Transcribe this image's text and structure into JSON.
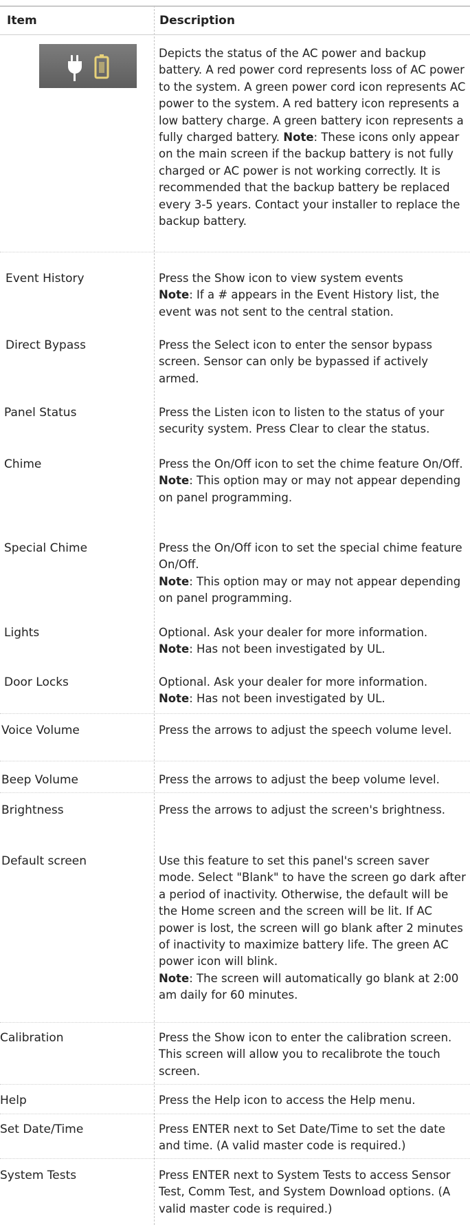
{
  "header": {
    "item": "Item",
    "description": "Description"
  },
  "colors": {
    "icon_background": "#666666",
    "icon_foreground": "#ffffff"
  },
  "rows": [
    {
      "item": "",
      "icons": [
        "ac-power-cord-icon",
        "backup-battery-icon"
      ],
      "description": "Depicts the status of the AC power and backup battery. A red power cord represents loss of AC power to the system. A green power cord icon represents AC power to the system. A red battery icon represents a low battery charge. A green battery icon represents a fully charged battery.",
      "note_label": "Note",
      "note": ": These icons only appear on the main screen if the backup battery is not fully charged or AC power is not working correctly. It is recommended that the  backup battery be replaced every 3-5 years. Contact your installer to replace the backup battery."
    },
    {
      "item": "Event History",
      "description": "Press the Show icon to view system events",
      "note_label": "Note",
      "note": ": If a # appears in the Event History list, the event was not sent to the central station."
    },
    {
      "item": "Direct Bypass",
      "description": "Press the Select icon to enter the sensor bypass screen. Sensor can only be bypassed if actively armed."
    },
    {
      "item": "Panel Status",
      "description": "Press the Listen icon to listen to the status of your security system.  Press Clear to clear the status."
    },
    {
      "item": "Chime",
      "description": "Press the On/Off icon to set the chime feature On/Off.",
      "note_label": "Note",
      "note": ": This option may or may not appear depending on panel programming."
    },
    {
      "item": "Special Chime",
      "description": "Press the On/Off icon to set the special chime feature On/Off.",
      "note_label": "Note",
      "note": ": This option may or may not appear depending on panel programming."
    },
    {
      "item": "Lights",
      "description": "Optional.  Ask your dealer for more information.",
      "note_label": "Note",
      "note": ": Has not been investigated by UL."
    },
    {
      "item": "Door Locks",
      "description": "Optional.  Ask your dealer for more information.",
      "note_label": "Note",
      "note": ": Has not been investigated by UL."
    },
    {
      "item": "Voice Volume",
      "description": "Press the arrows to adjust the speech volume level."
    },
    {
      "item": "Beep Volume",
      "description": "Press the arrows to adjust the beep volume level."
    },
    {
      "item": "Brightness",
      "description": "Press the arrows to adjust the screen's brightness."
    },
    {
      "item": "Default screen",
      "description": "Use this feature to set this panel's screen saver mode. Select \"Blank\" to have the screen go dark after a period of inactivity. Otherwise, the default will be the Home screen and the screen will be lit. If AC power is lost, the screen will go blank after 2 minutes of inactivity to maximize battery life. The green AC power icon will blink.",
      "note_label": "Note",
      "note": ": The screen will automatically go blank at 2:00 am daily for 60 minutes."
    },
    {
      "item": "Calibration",
      "description": "Press the Show icon to enter the calibration screen.  This screen will allow you to recalibrote the touch screen."
    },
    {
      "item": "Help",
      "description": "Press the Help icon to access the Help menu."
    },
    {
      "item": "Set Date/Time",
      "description": "Press ENTER next to Set Date/Time to set the date and time. (A valid master code is required.)"
    },
    {
      "item": "System Tests",
      "description": "Press ENTER next to System Tests to access Sensor Test, Comm Test, and System Download options. (A valid master code is required.)"
    }
  ]
}
